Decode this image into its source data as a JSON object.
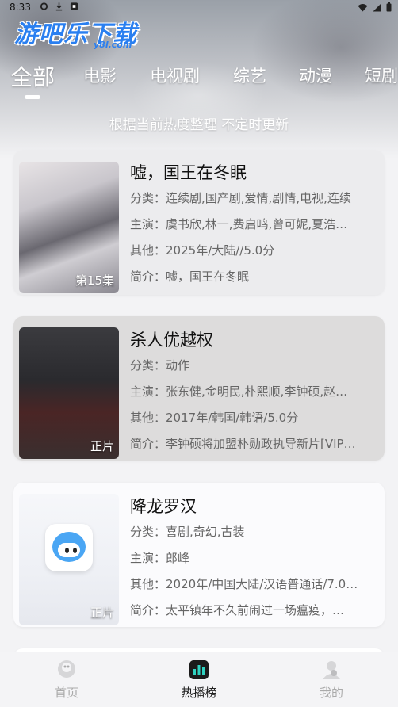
{
  "status_bar": {
    "time": "8:33"
  },
  "app": {
    "logo_main": "游吧乐下载",
    "logo_sub": "y8l.com"
  },
  "tabs": [
    {
      "label": "全部",
      "active": true
    },
    {
      "label": "电影"
    },
    {
      "label": "电视剧"
    },
    {
      "label": "综艺"
    },
    {
      "label": "动漫"
    },
    {
      "label": "短剧"
    }
  ],
  "notice": "根据当前热度整理 不定时更新",
  "field_labels": {
    "category": "分类：",
    "cast": "主演：",
    "other": "其他：",
    "intro": "简介："
  },
  "items": [
    {
      "title": "嘘，国王在冬眠",
      "category": "连续剧,国产剧,爱情,剧情,电视,连续",
      "cast": "虞书欣,林一,费启鸣,曾可妮,夏浩…",
      "other": "2025年/大陆//5.0分",
      "intro": "嘘，国王在冬眠",
      "tag": "第15集"
    },
    {
      "title": "杀人优越权",
      "category": "动作",
      "cast": "张东健,金明民,朴熙顺,李钟硕,赵…",
      "other": "2017年/韩国/韩语/5.0分",
      "intro": "李钟硕将加盟朴勋政执导新片[VIP…",
      "tag": "正片"
    },
    {
      "title": "降龙罗汉",
      "category": "喜剧,奇幻,古装",
      "cast": "郎峰",
      "other": "2020年/中国大陆/汉语普通话/7.0…",
      "intro": "太平镇年不久前闹过一场瘟疫，…",
      "tag": "正片"
    }
  ],
  "bottom_nav": [
    {
      "label": "首页",
      "icon": "home-icon"
    },
    {
      "label": "热播榜",
      "icon": "chart-icon",
      "active": true
    },
    {
      "label": "我的",
      "icon": "profile-icon"
    }
  ],
  "colors": {
    "brand": "#2a7ff0",
    "active_nav": "#222222"
  }
}
